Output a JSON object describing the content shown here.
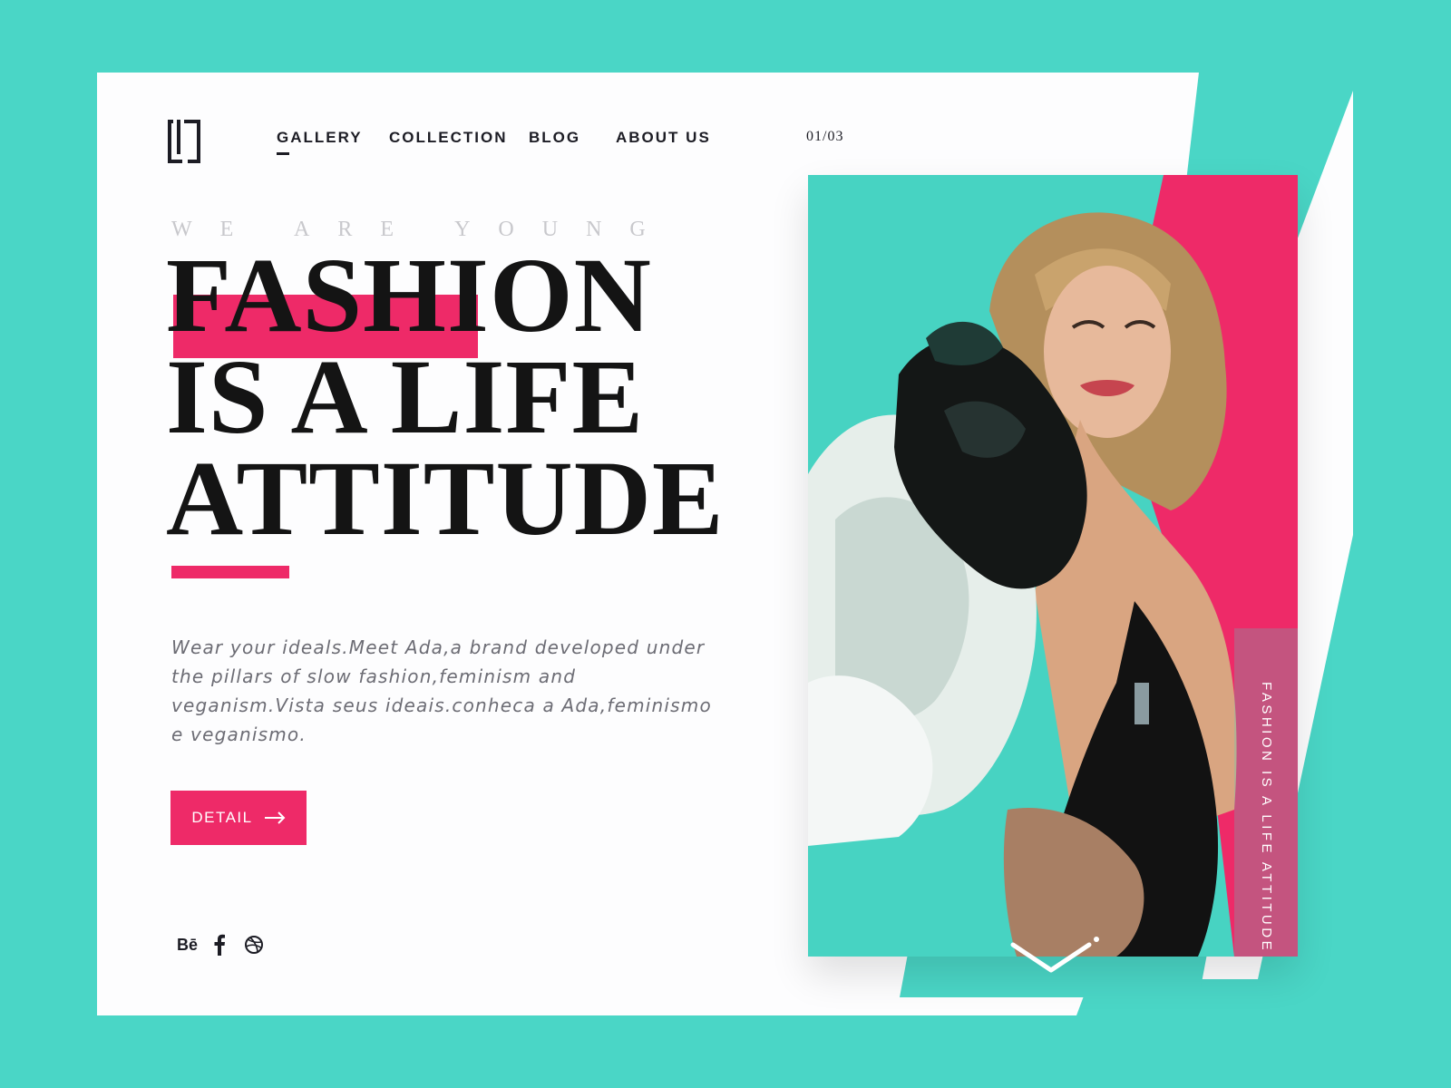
{
  "colors": {
    "background": "#4ad6c6",
    "accent": "#ee2a68",
    "text": "#1c1c24"
  },
  "logo": {
    "icon": "lj-monogram-icon"
  },
  "nav": {
    "items": [
      {
        "label": "GALLERY",
        "active": true
      },
      {
        "label": "COLLECTION",
        "active": false
      },
      {
        "label": "BLOG",
        "active": false
      },
      {
        "label": "ABOUT US",
        "active": false
      }
    ]
  },
  "pager": {
    "current": "01",
    "total": "03"
  },
  "hero": {
    "tagline": "WE  ARE  YOUNG",
    "headline_lines": [
      "FASHION",
      "IS A LIFE",
      "ATTITUDE"
    ],
    "description": "Wear your ideals.Meet Ada,a brand developed under the pillars of slow fashion,feminism and veganism.Vista seus ideais.conheca a Ada,feminismo e veganismo.",
    "cta_label": "DETAIL"
  },
  "social": [
    {
      "name": "Bē",
      "icon": "behance-icon"
    },
    {
      "name": "facebook",
      "icon": "facebook-icon"
    },
    {
      "name": "dribbble",
      "icon": "dribbble-icon"
    }
  ],
  "photo": {
    "vertical_caption": "FASHION IS A LIFE ATTITUDE"
  }
}
